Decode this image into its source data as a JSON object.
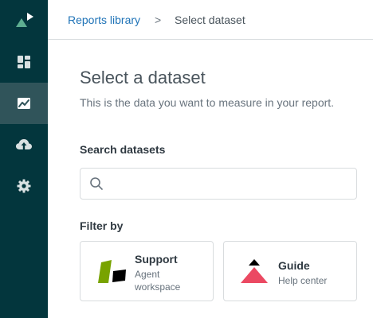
{
  "sidebar": {
    "logo_icon": "zendesk-explore-logo-icon",
    "items": [
      {
        "icon": "dashboard-icon",
        "active": false
      },
      {
        "icon": "reports-chart-icon",
        "active": true
      },
      {
        "icon": "upload-cloud-icon",
        "active": false
      },
      {
        "icon": "gear-icon",
        "active": false
      }
    ],
    "colors": {
      "background": "#03363d",
      "active": "#30545a",
      "icon": "#ffffff",
      "logo_accent": "#5eae91"
    }
  },
  "breadcrumb": {
    "link_label": "Reports library",
    "separator": ">",
    "current_label": "Select dataset"
  },
  "main": {
    "title": "Select a dataset",
    "description": "This is the data you want to measure in your report.",
    "search": {
      "label": "Search datasets",
      "value": "",
      "placeholder": ""
    },
    "filter_label": "Filter by",
    "filters": [
      {
        "title": "Support",
        "subtitle": "Agent workspace",
        "logo": "support-product-logo",
        "color": "#78a300"
      },
      {
        "title": "Guide",
        "subtitle": "Help center",
        "logo": "guide-product-logo",
        "color": "#eb4962"
      }
    ]
  },
  "colors": {
    "link": "#1f73b7",
    "border": "#d8dcde",
    "text": "#2f3941",
    "muted": "#68737d"
  }
}
